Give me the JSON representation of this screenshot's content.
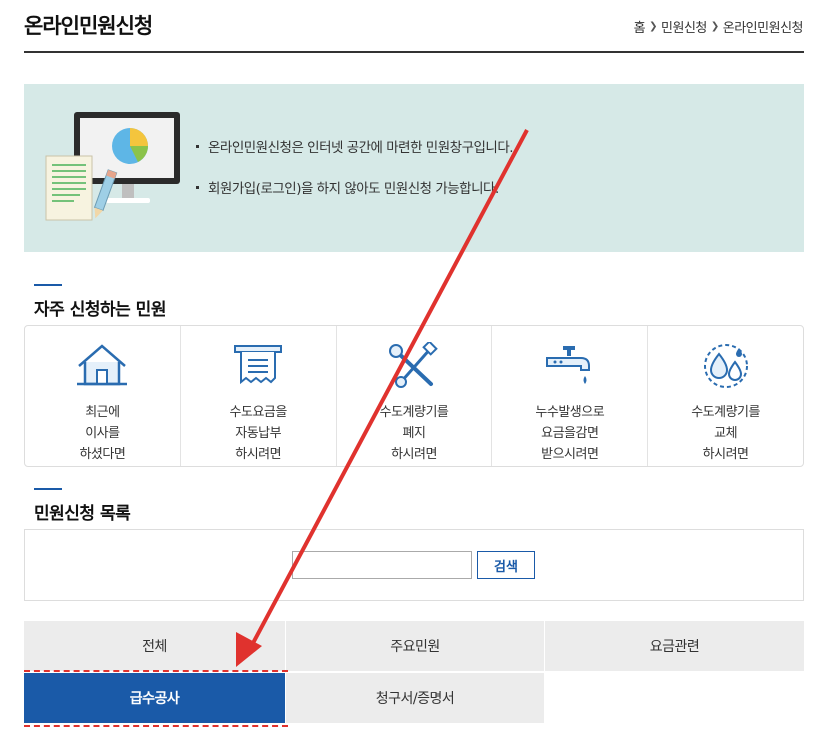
{
  "header": {
    "title": "온라인민원신청",
    "breadcrumb": [
      "홈",
      "민원신청",
      "온라인민원신청"
    ]
  },
  "intro": {
    "lines": [
      "온라인민원신청은 인터넷 공간에 마련한 민원창구입니다.",
      "회원가입(로그인)을 하지 않아도 민원신청 가능합니다."
    ],
    "illustration_icon": "computer-pie-chart-document-icon"
  },
  "frequent": {
    "title": "자주 신청하는 민원",
    "items": [
      {
        "label": "최근에\n이사를\n하셨다면",
        "icon": "house-icon"
      },
      {
        "label": "수도요금을\n자동납부\n하시려면",
        "icon": "bill-icon"
      },
      {
        "label": "수도계량기를\n폐지\n하시려면",
        "icon": "tools-icon"
      },
      {
        "label": "누수발생으로\n요금을감면\n받으시려면",
        "icon": "faucet-leak-icon"
      },
      {
        "label": "수도계량기를\n교체\n하시려면",
        "icon": "water-drops-icon"
      }
    ]
  },
  "list": {
    "title": "민원신청 목록",
    "search_value": "",
    "search_label": "검색"
  },
  "tabs": {
    "row1": [
      "전체",
      "주요민원",
      "요금관련"
    ],
    "row2": [
      "급수공사",
      "청구서/증명서"
    ],
    "active": "급수공사"
  },
  "colors": {
    "accent": "#1a5aa8",
    "intro_bg": "#d6e9e7",
    "annotation_arrow": "#e0322e"
  }
}
